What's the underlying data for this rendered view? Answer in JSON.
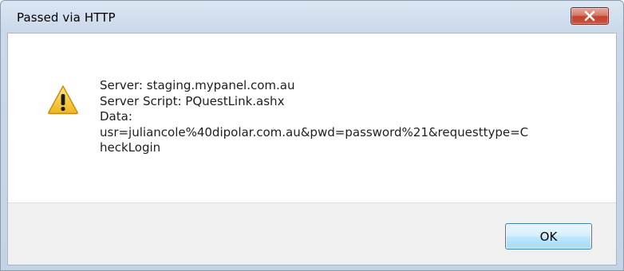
{
  "dialog": {
    "title": "Passed via HTTP",
    "icon": "warning-icon",
    "message_lines": [
      "Server: staging.mypanel.com.au",
      "Server Script: PQuestLink.ashx",
      "Data:",
      "usr=juliancole%40dipolar.com.au&pwd=password%21&requesttype=C",
      "heckLogin"
    ],
    "ok_label": "OK"
  },
  "colors": {
    "close_button": "#c8543f",
    "warning_fill": "#f2c230",
    "ok_border": "#3c7fb1"
  }
}
